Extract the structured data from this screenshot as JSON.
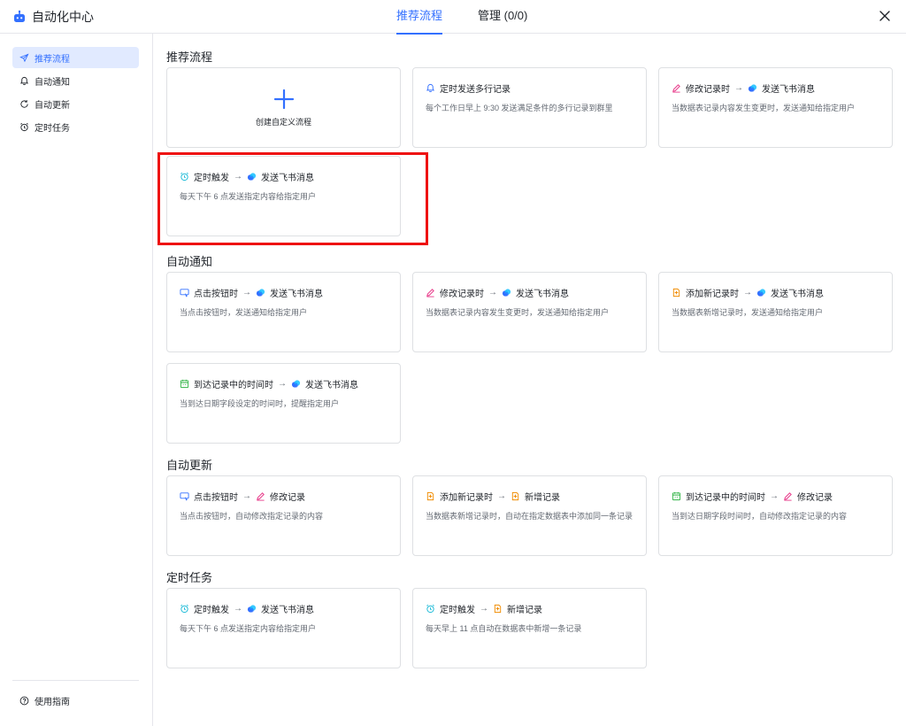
{
  "header": {
    "app_title": "自动化中心",
    "tabs": [
      {
        "label": "推荐流程",
        "active": true
      },
      {
        "label": "管理 (0/0)",
        "active": false
      }
    ]
  },
  "sidebar": {
    "items": [
      {
        "label": "推荐流程",
        "icon": "rocket-icon",
        "active": true
      },
      {
        "label": "自动通知",
        "icon": "bell-icon",
        "active": false
      },
      {
        "label": "自动更新",
        "icon": "refresh-icon",
        "active": false
      },
      {
        "label": "定时任务",
        "icon": "clock-icon",
        "active": false
      }
    ],
    "guide_label": "使用指南"
  },
  "sections": {
    "recommend": {
      "title": "推荐流程",
      "create_label": "创建自定义流程",
      "cards": [
        {
          "trigger": "定时发送多行记录",
          "action": "",
          "desc": "每个工作日早上 9:30 发送满足条件的多行记录到群里"
        },
        {
          "trigger": "修改记录时",
          "action": "发送飞书消息",
          "desc": "当数据表记录内容发生变更时，发送通知给指定用户"
        },
        {
          "trigger": "定时触发",
          "action": "发送飞书消息",
          "desc": "每天下午 6 点发送指定内容给指定用户"
        }
      ]
    },
    "notify": {
      "title": "自动通知",
      "cards": [
        {
          "trigger": "点击按钮时",
          "action": "发送飞书消息",
          "desc": "当点击按钮时，发送通知给指定用户"
        },
        {
          "trigger": "修改记录时",
          "action": "发送飞书消息",
          "desc": "当数据表记录内容发生变更时，发送通知给指定用户"
        },
        {
          "trigger": "添加新记录时",
          "action": "发送飞书消息",
          "desc": "当数据表新增记录时，发送通知给指定用户"
        },
        {
          "trigger": "到达记录中的时间时",
          "action": "发送飞书消息",
          "desc": "当到达日期字段设定的时间时，提醒指定用户"
        }
      ]
    },
    "update": {
      "title": "自动更新",
      "cards": [
        {
          "trigger": "点击按钮时",
          "action": "修改记录",
          "desc": "当点击按钮时，自动修改指定记录的内容"
        },
        {
          "trigger": "添加新记录时",
          "action": "新增记录",
          "desc": "当数据表新增记录时，自动在指定数据表中添加同一条记录"
        },
        {
          "trigger": "到达记录中的时间时",
          "action": "修改记录",
          "desc": "当到达日期字段时间时，自动修改指定记录的内容"
        }
      ]
    },
    "schedule": {
      "title": "定时任务",
      "cards": [
        {
          "trigger": "定时触发",
          "action": "发送飞书消息",
          "desc": "每天下午 6 点发送指定内容给指定用户"
        },
        {
          "trigger": "定时触发",
          "action": "新增记录",
          "desc": "每天早上 11 点自动在数据表中新增一条记录"
        }
      ]
    }
  },
  "arrow_symbol": "→",
  "colors": {
    "accent": "#3370ff",
    "highlight": "#ee1111"
  }
}
